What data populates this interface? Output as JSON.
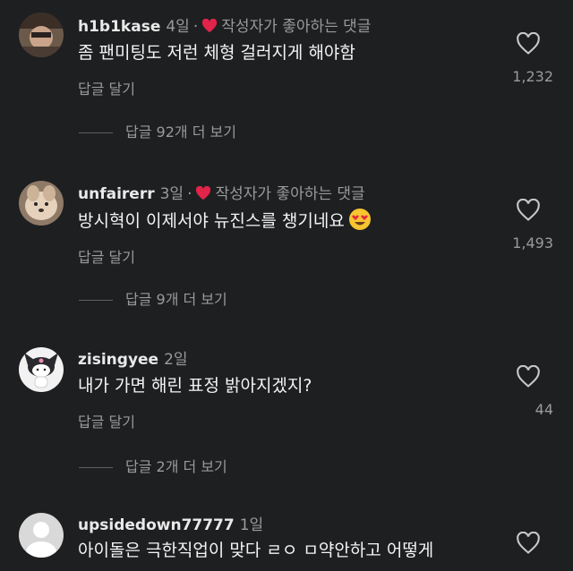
{
  "comments": [
    {
      "username": "h1b1kase",
      "time": "4일",
      "liked_label": "작성자가 좋아하는 댓글",
      "text": "좀 팬미팅도 저런 체형 걸러지게 해야함",
      "reply": "답글 달기",
      "like_count": "1,232",
      "more": "답글 92개 더 보기",
      "avatar": "face-photo"
    },
    {
      "username": "unfairerr",
      "time": "3일",
      "liked_label": "작성자가 좋아하는 댓글",
      "text": "방시혁이 이제서야 뉴진스를 챙기네요",
      "emoji": "heart-eyes-emoji",
      "reply": "답글 달기",
      "like_count": "1,493",
      "more": "답글 9개 더 보기",
      "avatar": "dog-photo"
    },
    {
      "username": "zisingyee",
      "time": "2일",
      "text": "내가 가면 해린 표정 밝아지겠지?",
      "reply": "답글 달기",
      "like_count": "44",
      "more": "답글 2개 더 보기",
      "avatar": "kuromi-character"
    },
    {
      "username": "upsidedown77777",
      "time": "1일",
      "text": "아이돌은 극한직업이 맞다 ㄹㅇ ㅁ약안하고 어떻게",
      "avatar": "default-avatar"
    }
  ],
  "colors": {
    "background": "#1e1f21",
    "liked_heart": "#e0244a",
    "secondary_text": "#9a9a9a"
  }
}
